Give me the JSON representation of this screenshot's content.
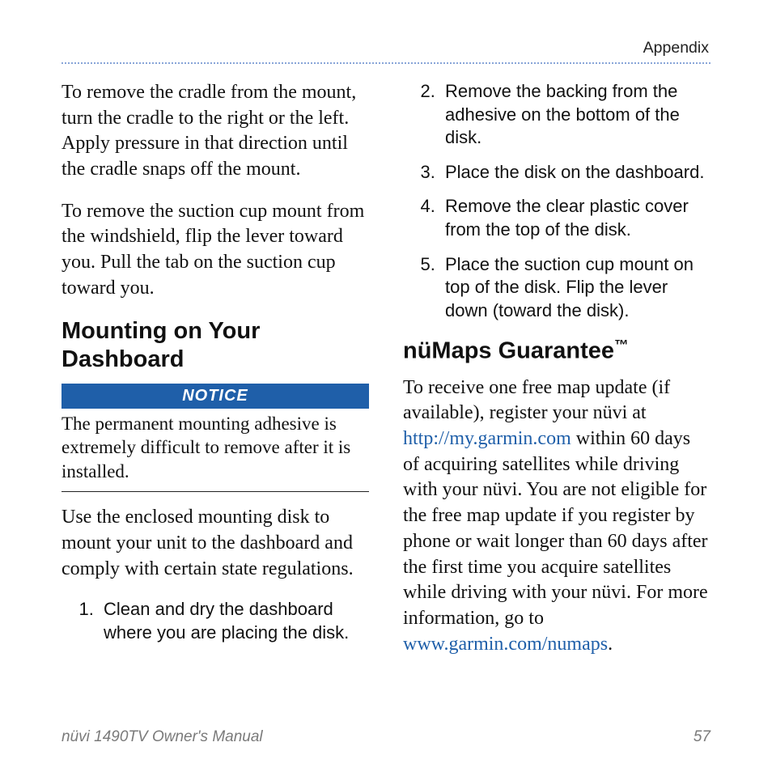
{
  "header": {
    "appendix": "Appendix"
  },
  "col1": {
    "p1": "To remove the cradle from the mount, turn the cradle to the right or the left. Apply pressure in that direction until the cradle snaps off the mount.",
    "p2": "To remove the suction cup mount from the windshield, flip the lever toward you. Pull the tab on the suction cup toward you.",
    "h_mount": "Mounting on Your Dashboard",
    "notice_label": "NOTICE",
    "notice_body": "The permanent mounting adhesive is extremely difficult to remove after it is installed.",
    "p3": "Use the enclosed mounting disk to mount your unit to the dashboard and comply with certain state regulations.",
    "step1": "Clean and dry the dashboard where you are placing the disk."
  },
  "col2": {
    "step2": "Remove the backing from the adhesive on the bottom of the disk.",
    "step3": "Place the disk on the dashboard.",
    "step4": "Remove the clear plastic cover from the top of the disk.",
    "step5": "Place the suction cup mount on top of the disk. Flip the lever down (toward the disk).",
    "h_numaps": "nüMaps Guarantee",
    "p_guarantee_a": "To receive one free map update (if available), register your nüvi at ",
    "link1": "http://my.garmin.com",
    "p_guarantee_b": " within 60 days of acquiring satellites while driving with your nüvi. You are not eligible for the free map update if you register by phone or wait longer than 60 days after the first time you acquire satellites while driving with your nüvi. For more information, go to ",
    "link2": "www.garmin.com/numaps",
    "p_guarantee_c": "."
  },
  "footer": {
    "manual": "nüvi 1490TV Owner's Manual",
    "page": "57"
  }
}
